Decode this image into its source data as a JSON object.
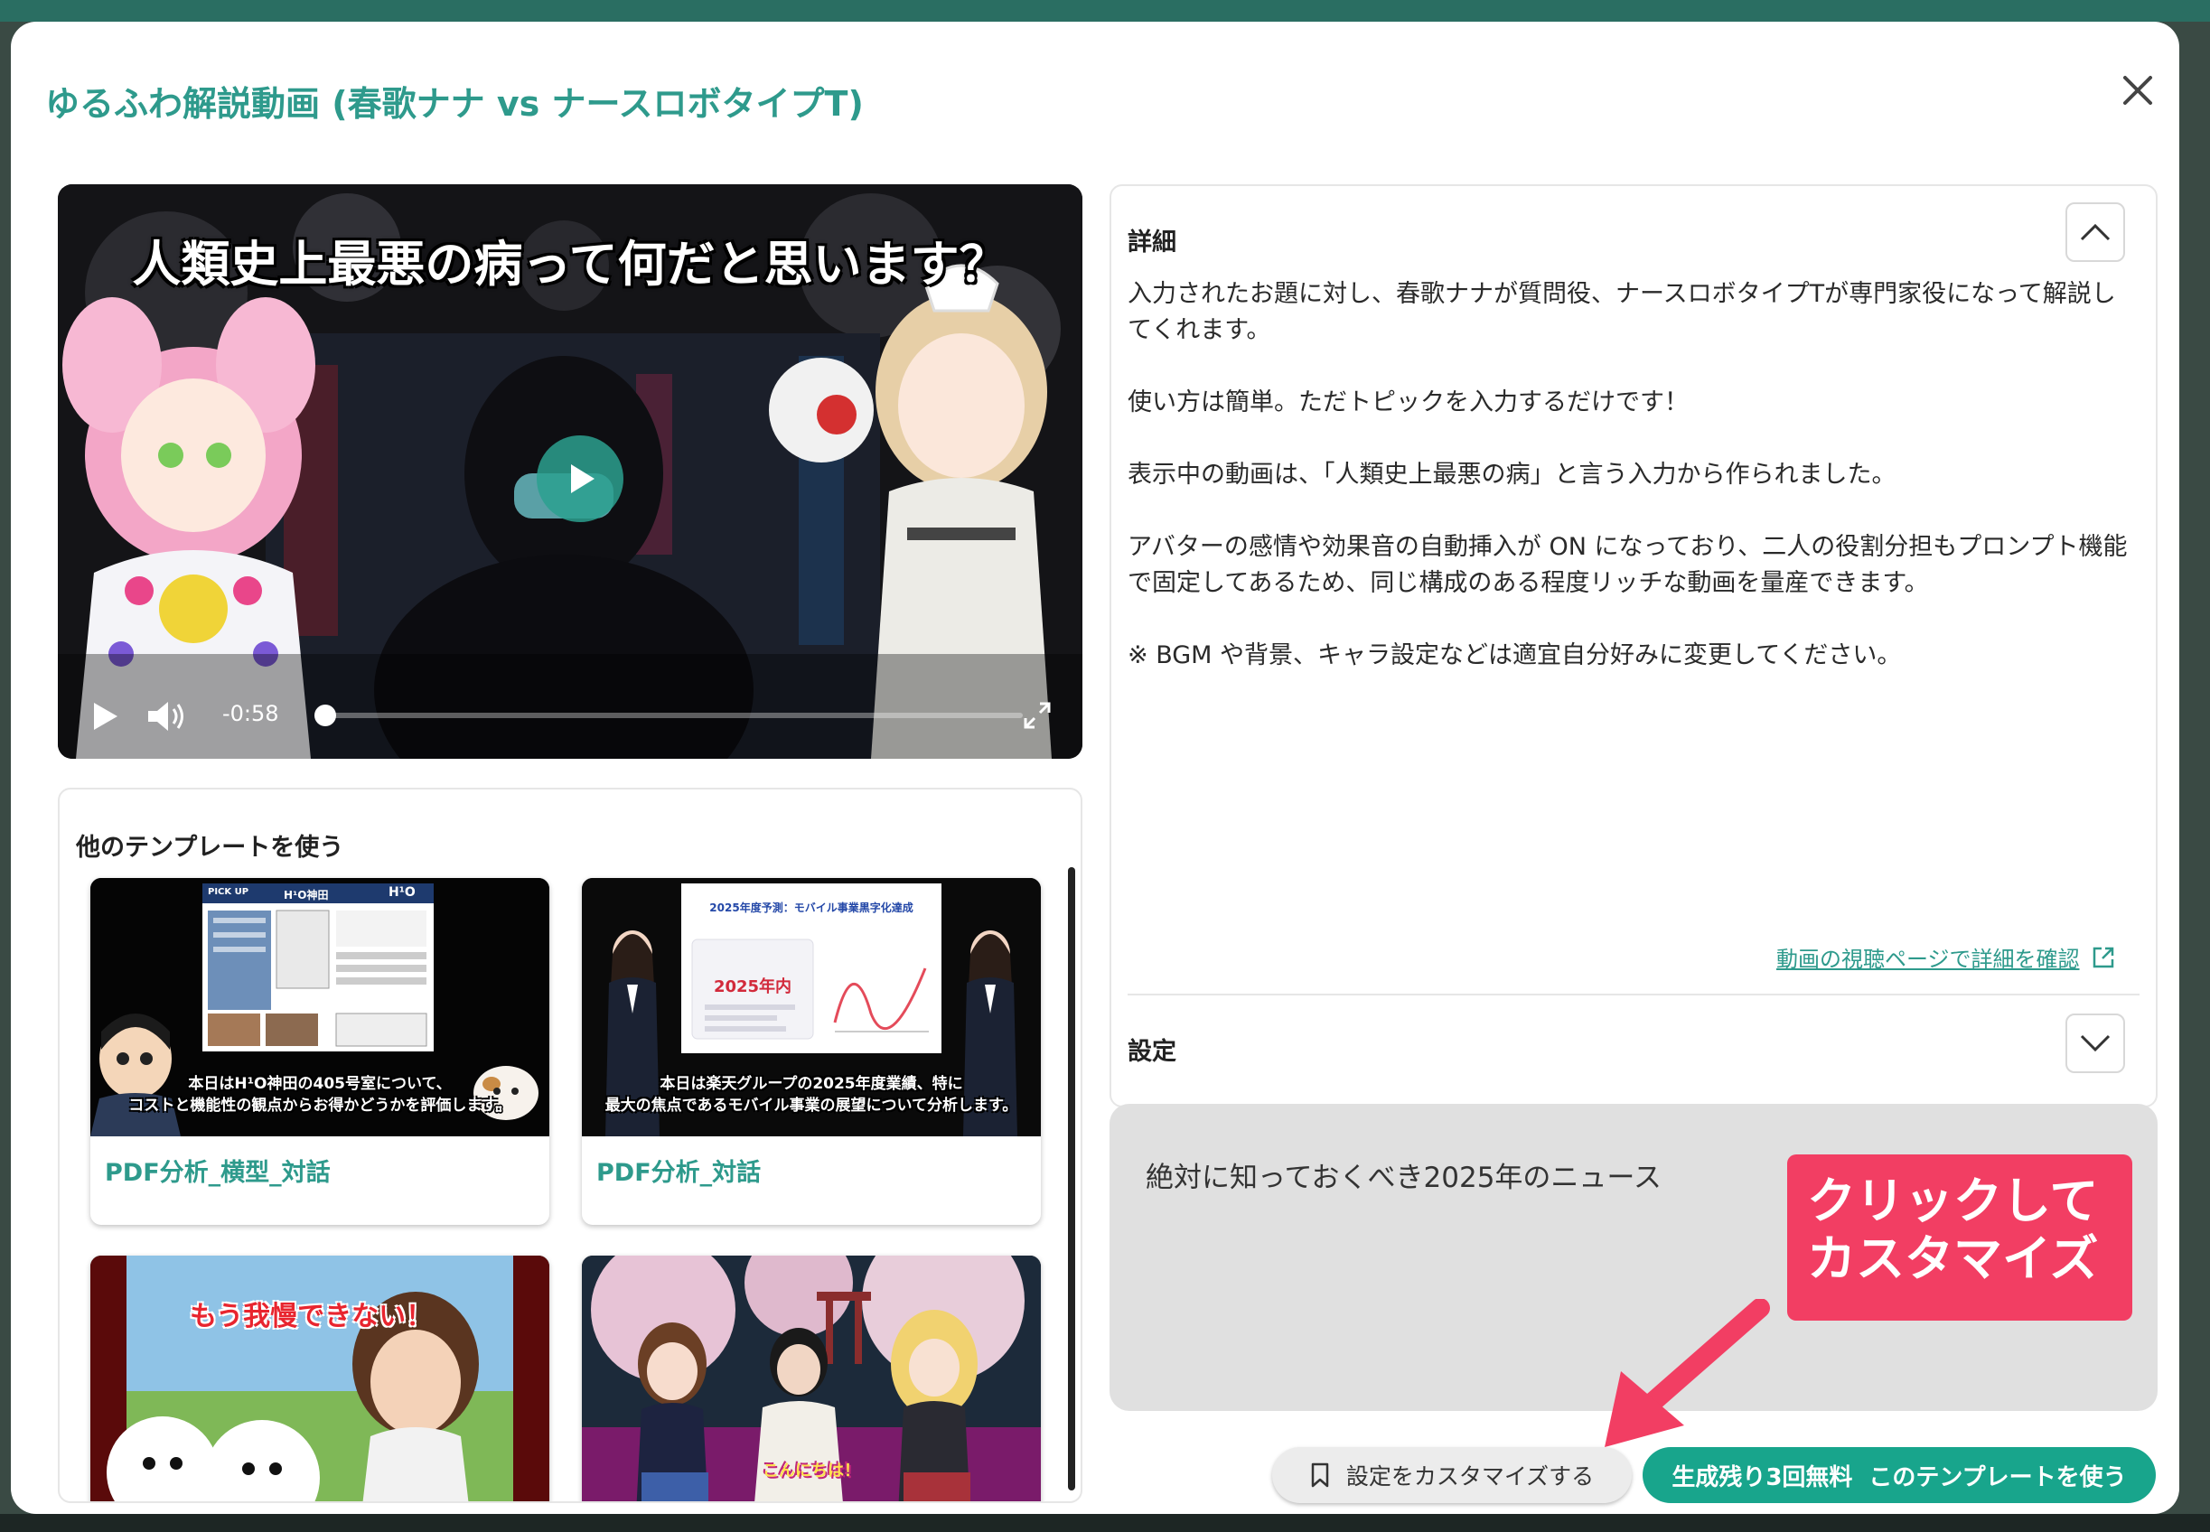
{
  "modal": {
    "title": "ゆるふわ解説動画 (春歌ナナ vs ナースロボタイプT)",
    "close_icon": "close-icon"
  },
  "video": {
    "caption": "人類史上最悪の病って何だと思います？",
    "time": "-0:58",
    "progress": 0.0,
    "icons": [
      "play-icon",
      "volume-icon",
      "fullscreen-icon"
    ]
  },
  "templates": {
    "heading": "他のテンプレートを使う",
    "cards": [
      {
        "label": "PDF分析_横型_対話",
        "subtitle_line1": "本日はH¹O神田の405号室について、",
        "subtitle_line2": "コストと機能性の観点からお得かどうかを評価します。",
        "doc_header": "H¹O神田",
        "doc_tag": "PICK UP",
        "doc_logo": "H¹O"
      },
      {
        "label": "PDF分析_対話",
        "subtitle_line1": "本日は楽天グループの2025年度業績、特に",
        "subtitle_line2": "最大の焦点であるモバイル事業の展望について分析します。",
        "slide_title": "2025年度予測：モバイル事業黒字化達成",
        "slide_highlight": "2025年内"
      },
      {
        "caption": "もう我慢できない！"
      },
      {
        "caption": "こんにちは！"
      }
    ]
  },
  "details": {
    "heading": "詳細",
    "paragraphs": [
      "入力されたお題に対し、春歌ナナが質問役、ナースロボタイプTが専門家役になって解説してくれます。",
      "使い方は簡単。ただトピックを入力するだけです！",
      "表示中の動画は、「人類史上最悪の病」と言う入力から作られました。",
      "アバターの感情や効果音の自動挿入が ON になっており、二人の役割分担もプロンプト機能で固定してあるため、同じ構成のある程度リッチな動画を量産できます。",
      "※ BGM や背景、キャラ設定などは適宜自分好みに変更してください。"
    ],
    "watch_link": "動画の視聴ページで詳細を確認",
    "settings_heading": "設定"
  },
  "input": {
    "value": "絶対に知っておくべき2025年のニュース"
  },
  "callout": {
    "line1": "クリックして",
    "line2": "カスタマイズ"
  },
  "buttons": {
    "customize": "設定をカスタマイズする",
    "remaining": "生成残り3回無料",
    "use": "このテンプレートを使う"
  },
  "colors": {
    "accent": "#2e9a8c",
    "primary_button": "#18a58c",
    "callout": "#f23e63",
    "input_bg": "#e0e0e0"
  }
}
